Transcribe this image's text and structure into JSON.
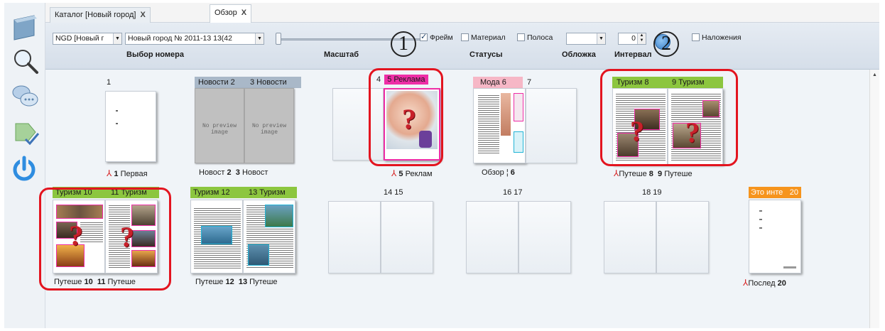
{
  "tabs": [
    {
      "label": "Каталог [Новый город]",
      "close": "X"
    },
    {
      "label": "Обзор",
      "close": "X"
    }
  ],
  "toolbar": {
    "edition_combo": "NGD [Новый г",
    "issue_combo": "Новый город № 2011-13 13(42",
    "frame_label": "Фрейм",
    "material_label": "Материал",
    "stripe_label": "Полоса",
    "interval_value": "0",
    "overlay_label": "Наложения",
    "section_labels": {
      "select": "Выбор номера",
      "scale": "Масштаб",
      "statuses": "Статусы",
      "cover": "Обложка",
      "interval": "Интервал"
    },
    "callout_1": "1",
    "callout_2": "2"
  },
  "spreads_row1": [
    {
      "header": "1",
      "footer_name": "Первая",
      "footer_num": "1"
    },
    {
      "header_left": "Новости 2",
      "header_right": "3 Новости",
      "no_preview": "No preview image",
      "footer_left": "Новост",
      "footer_left_num": "2",
      "footer_right": "Новост",
      "footer_right_num": "3"
    },
    {
      "header_left": "4",
      "header_right": "5 Реклама",
      "footer_name": "Реклам",
      "footer_num": "5"
    },
    {
      "header_left": "Мода 6",
      "header_right": "7",
      "footer_name": "Обзор ¦",
      "footer_num": "6"
    },
    {
      "header_left": "Туризм 8",
      "header_right": "9 Туризм",
      "footer_left": "Путеше",
      "footer_left_num": "8",
      "footer_right": "Путеше",
      "footer_right_num": "9"
    }
  ],
  "spreads_row2": [
    {
      "header_left": "Туризм 10",
      "header_right": "11 Туризм",
      "footer_left": "Путеше",
      "footer_left_num": "10",
      "footer_right": "Путеше",
      "footer_right_num": "11"
    },
    {
      "header_left": "Туризм 12",
      "header_right": "13 Туризм",
      "footer_left": "Путеше",
      "footer_left_num": "12",
      "footer_right": "Путеше",
      "footer_right_num": "13"
    },
    {
      "header": "14  15"
    },
    {
      "header": "16  17"
    },
    {
      "header": "18  19"
    },
    {
      "header_left": "Это инте",
      "header_right": "20",
      "footer_name": "Послед",
      "footer_num": "20"
    }
  ],
  "colors": {
    "tourism": "#8cc63f",
    "news": "#a9b8c8",
    "ads": "#ee2ea6",
    "fashion": "#f6b7c6",
    "other": "#f6941d",
    "highlight": "#e3141f"
  }
}
